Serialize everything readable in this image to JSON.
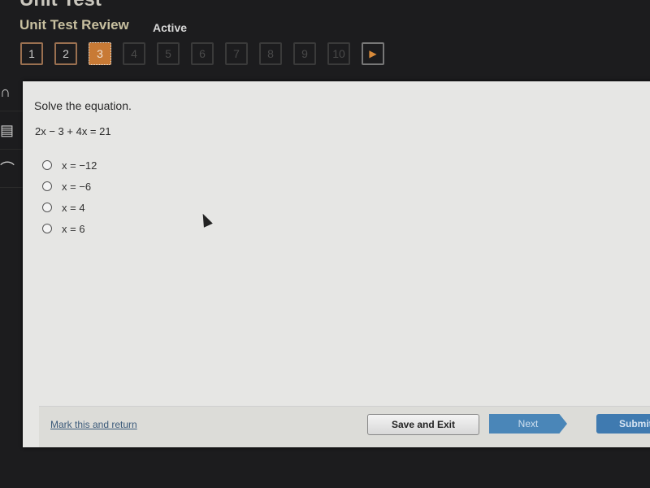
{
  "header": {
    "title": "Unit Test",
    "subtitle": "Unit Test Review",
    "status": "Active"
  },
  "question_nav": {
    "items": [
      {
        "label": "1",
        "state": "answered"
      },
      {
        "label": "2",
        "state": "answered"
      },
      {
        "label": "3",
        "state": "current"
      },
      {
        "label": "4",
        "state": "locked"
      },
      {
        "label": "5",
        "state": "locked"
      },
      {
        "label": "6",
        "state": "locked"
      },
      {
        "label": "7",
        "state": "locked"
      },
      {
        "label": "8",
        "state": "locked"
      },
      {
        "label": "9",
        "state": "locked"
      },
      {
        "label": "10",
        "state": "locked"
      }
    ],
    "next_icon": "▶"
  },
  "tools": [
    {
      "icon": "headphones-icon",
      "glyph": "∩"
    },
    {
      "icon": "calculator-icon",
      "glyph": "▤"
    },
    {
      "icon": "pen-icon",
      "glyph": "⌒"
    }
  ],
  "question": {
    "prompt": "Solve the equation.",
    "equation": "2x − 3 + 4x = 21",
    "choices": [
      "x = −12",
      "x = −6",
      "x = 4",
      "x = 6"
    ]
  },
  "footer": {
    "mark_link": "Mark this and return",
    "save_exit": "Save and Exit",
    "next": "Next",
    "submit": "Submit"
  }
}
